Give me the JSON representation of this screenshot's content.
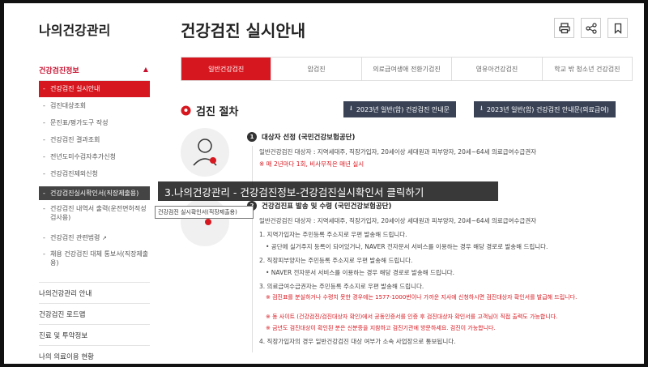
{
  "sidebar": {
    "title": "나의건강관리",
    "section": "건강검진정보",
    "items": [
      {
        "label": "건강검진 실시안내"
      },
      {
        "label": "검진대상조회"
      },
      {
        "label": "문진표/평가도구 작성"
      },
      {
        "label": "건강검진 결과조회"
      },
      {
        "label": "전년도미수검자추가신청"
      },
      {
        "label": "건강검진제외신청"
      },
      {
        "label": "건강검진실시확인서(직장제출용)"
      },
      {
        "label": "건강검진 내역서 출력(운전면허적성검사용)"
      },
      {
        "label": "건강검진 관련법령"
      },
      {
        "label": "채용 건강검진 대체 통보서(직장제출용)"
      }
    ],
    "main_items": [
      {
        "label": "나의건강관리 안내"
      },
      {
        "label": "건강검진 로드맵"
      },
      {
        "label": "진료 및 투약정보"
      },
      {
        "label": "나의 의료이용 현황"
      }
    ]
  },
  "header": {
    "title": "건강검진 실시안내"
  },
  "tabs": [
    {
      "label": "일반건강검진"
    },
    {
      "label": "암검진"
    },
    {
      "label": "의료급여생애 전환기검진"
    },
    {
      "label": "영유아건강검진"
    },
    {
      "label": "학교 밖 청소년 건강검진"
    }
  ],
  "process": {
    "title": "검진 절차",
    "download1": "2023년 일반(암) 건강검진 안내문",
    "download2": "2023년 일반(암) 건강검진 안내문(의료급여)"
  },
  "step1": {
    "num": "1",
    "title": "대상자 선정 (국민건강보험공단)",
    "line1": "일반건강검진 대상자 : 지역세대주, 직장가입자, 20세이상 세대원과 피부양자, 20세~64세 의료급여수급권자",
    "line2": "※ 매 2년마다 1회, 비사무직은 매년 실시"
  },
  "step2": {
    "num": "2",
    "title": "건강검진표 발송 및 수령 (국민건강보험공단)",
    "line1": "일반건강검진 대상자 : 지역세대주, 직장가입자, 20세이상 세대원과 피부양자, 20세~64세 의료급여수급권자",
    "l1": "1. 지역가입자는 주민등록 주소지로 우편 발송해 드립니다.",
    "l2": "• 공단에 실거주지 등록이 되어있거나, NAVER 전자문서 서비스를 이용하는 경우 해당 경로로 발송해 드립니다.",
    "l3": "2. 직장피부양자는 주민등록 주소지로 우편 발송해 드립니다.",
    "l4": "• NAVER 전자문서 서비스를 이용하는 경우 해당 경로로 발송해 드립니다.",
    "l5": "3. 의료급여수급권자는 주민등록 주소지로 우편 발송해 드립니다.",
    "r1": "※ 검진표를 분실하거나 수령치 못한 경우에는 1577-1000번이나 가까운 지사에 신청하시면 검진대상자 확인서를 발급해 드립니다.",
    "r2": "※ 동 사이트 (건강검진/검진대상자 확인)에서 공동인증서를 인증 후 검진대상자 확인서를 고객님이 직접 출력도 가능합니다.",
    "r3": "※ 금년도 검진대상이 확인된 분은 신분증을 지참하고 검진기관에 방문하세요. 검진이 가능합니다.",
    "l6": "4. 직장가입자의 경우 일반건강검진 대상 여부가 소속 사업장으로 통보됩니다."
  },
  "overlay": {
    "caption": "3.나의건강관리 - 건강검진정보-건강검진실시확인서 클릭하기",
    "tooltip": "건강검진 실시확인서(직장제출용)"
  }
}
